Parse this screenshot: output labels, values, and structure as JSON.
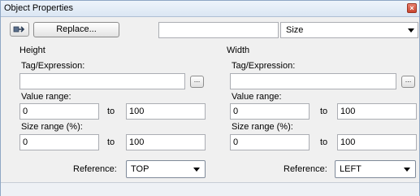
{
  "window": {
    "title": "Object Properties"
  },
  "toolbar": {
    "replace_label": "Replace...",
    "name_value": "",
    "type_select": {
      "selected": "Size"
    }
  },
  "height": {
    "title": "Height",
    "tag_label": "Tag/Expression:",
    "tag_value": "",
    "browse_label": "...",
    "value_range_label": "Value range:",
    "value_from": "0",
    "value_to_label": "to",
    "value_to": "100",
    "size_range_label": "Size range (%):",
    "size_from": "0",
    "size_to_label": "to",
    "size_to": "100",
    "reference_label": "Reference:",
    "reference_value": "TOP"
  },
  "width": {
    "title": "Width",
    "tag_label": "Tag/Expression:",
    "tag_value": "",
    "browse_label": "...",
    "value_range_label": "Value range:",
    "value_from": "0",
    "value_to_label": "to",
    "value_to": "100",
    "size_range_label": "Size range (%):",
    "size_from": "0",
    "size_to_label": "to",
    "size_to": "100",
    "reference_label": "Reference:",
    "reference_value": "LEFT"
  }
}
